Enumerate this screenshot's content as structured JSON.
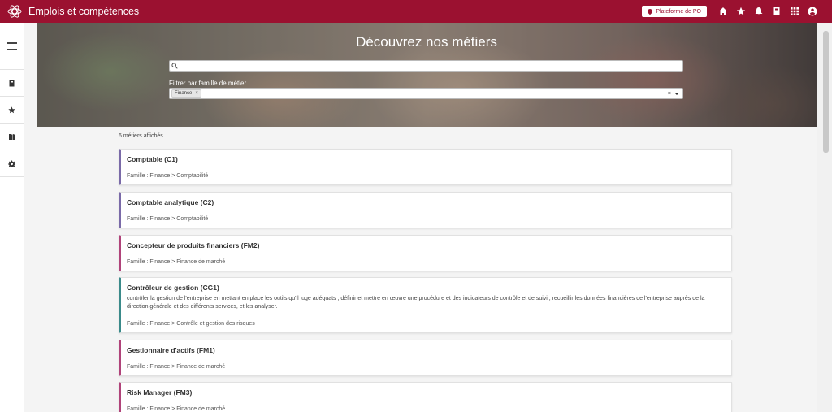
{
  "header": {
    "app_title": "Emplois et compétences",
    "platform_label": "Plateforme de PO",
    "brand_color": "#9b1130",
    "icons": [
      "home-icon",
      "star-icon",
      "bell-icon",
      "book-icon",
      "apps-grid-icon",
      "user-account-icon"
    ]
  },
  "sidebar": {
    "items": [
      {
        "icon": "menu-icon"
      },
      {
        "icon": "book-icon"
      },
      {
        "icon": "star-icon"
      },
      {
        "icon": "library-icon"
      },
      {
        "icon": "gear-icon"
      }
    ]
  },
  "hero": {
    "title": "Découvrez nos métiers",
    "search_value": "",
    "filter_label": "Filtrer par famille de métier :",
    "filter_chip": "Finance",
    "chip_remove": "×",
    "clear": "×"
  },
  "results": {
    "count_text": "6 métiers affichés",
    "cards": [
      {
        "title": "Comptable (C1)",
        "description": "",
        "family": "Famille : Finance > Comptabilité",
        "accent": "#7a6aa8"
      },
      {
        "title": "Comptable analytique (C2)",
        "description": "",
        "family": "Famille : Finance > Comptabilité",
        "accent": "#7a6aa8"
      },
      {
        "title": "Concepteur de produits financiers (FM2)",
        "description": "",
        "family": "Famille : Finance > Finance de marché",
        "accent": "#b0437a"
      },
      {
        "title": "Contrôleur de gestion (CG1)",
        "description": "contrôler la gestion de l'entreprise en mettant en place les outils qu'il juge adéquats ; définir et mettre en œuvre une procédure et des indicateurs de contrôle et de suivi ; recueillir les données financières de l'entreprise auprès de la direction générale et des différents services, et les analyser.",
        "family": "Famille : Finance > Contrôle et gestion des risques",
        "accent": "#3a8a8a"
      },
      {
        "title": "Gestionnaire d'actifs (FM1)",
        "description": "",
        "family": "Famille : Finance > Finance de marché",
        "accent": "#b0437a"
      },
      {
        "title": "Risk Manager (FM3)",
        "description": "",
        "family": "Famille : Finance > Finance de marché",
        "accent": "#b0437a"
      }
    ]
  }
}
